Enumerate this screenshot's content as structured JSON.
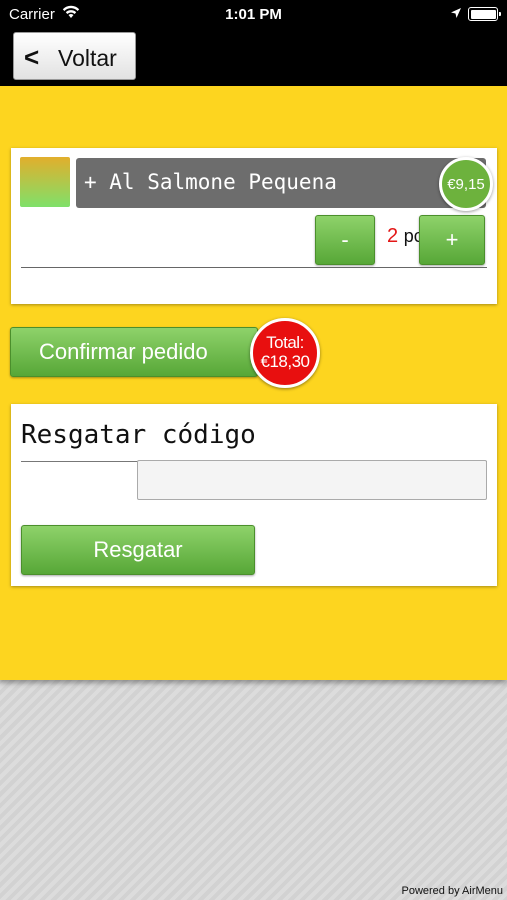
{
  "status_bar": {
    "carrier": "Carrier",
    "time": "1:01 PM"
  },
  "nav": {
    "back_label": "Voltar",
    "back_icon": "<"
  },
  "order": {
    "item_name": "+ Al Salmone Pequena",
    "price": "€9,15",
    "quantity": "2",
    "unit": "pc",
    "minus_label": "-",
    "plus_label": "+"
  },
  "confirm": {
    "label": "Confirmar pedido",
    "total_label": "Total:",
    "total_value": "€18,30"
  },
  "redeem": {
    "title": "Resgatar código",
    "input_value": "",
    "button_label": "Resgatar"
  },
  "footer": {
    "powered_by": "Powered by AirMenu"
  },
  "colors": {
    "yellow": "#fdd51f",
    "green": "#6db23d",
    "red": "#e80f0f",
    "gray_bar": "#6d6d6d"
  }
}
